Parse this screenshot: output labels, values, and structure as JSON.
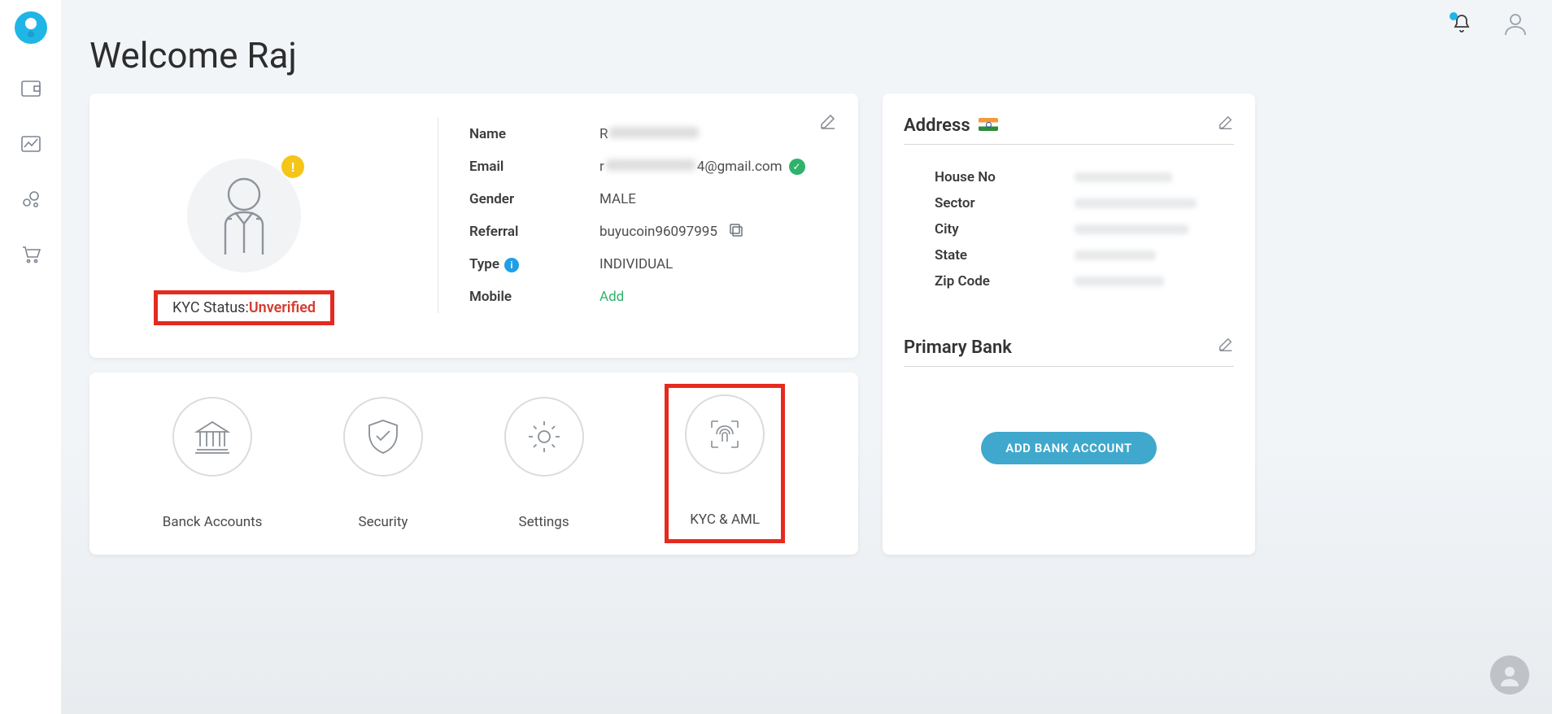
{
  "header": {
    "welcome": "Welcome Raj"
  },
  "profile": {
    "kyc_label": "KYC Status:",
    "kyc_value": "Unverified",
    "name_label": "Name",
    "email_label": "Email",
    "email_suffix": "4@gmail.com",
    "gender_label": "Gender",
    "gender_value": "MALE",
    "referral_label": "Referral",
    "referral_value": "buyucoin96097995",
    "type_label": "Type",
    "type_value": "INDIVIDUAL",
    "mobile_label": "Mobile",
    "mobile_add": "Add"
  },
  "actions": {
    "bank": "Banck Accounts",
    "security": "Security",
    "settings": "Settings",
    "kyc": "KYC & AML"
  },
  "address": {
    "title": "Address",
    "house": "House No",
    "sector": "Sector",
    "city": "City",
    "state": "State",
    "zip": "Zip Code"
  },
  "bank": {
    "title": "Primary Bank",
    "add_btn": "ADD BANK ACCOUNT"
  }
}
